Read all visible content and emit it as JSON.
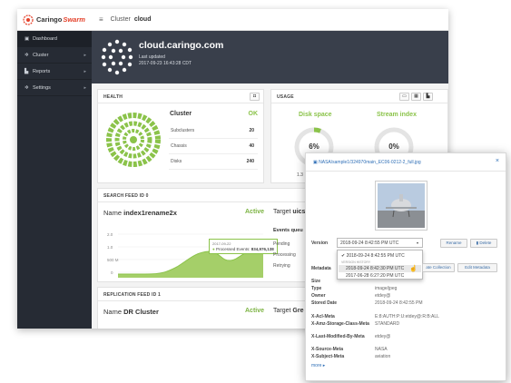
{
  "app": {
    "brand_name": "Caringo",
    "brand_product": "Swarm",
    "brand_color": "#e4412a"
  },
  "sidebar": {
    "items": [
      {
        "label": "Dashboard",
        "icon": "dashboard-icon",
        "has_chevron": false
      },
      {
        "label": "Cluster",
        "icon": "gear-icon",
        "has_chevron": true
      },
      {
        "label": "Reports",
        "icon": "bar-chart-icon",
        "has_chevron": true
      },
      {
        "label": "Settings",
        "icon": "gear-icon",
        "has_chevron": true
      }
    ]
  },
  "topbar": {
    "menu_icon": "hamburger-icon",
    "prefix": "Cluster",
    "name": "cloud"
  },
  "hero": {
    "cluster_name": "cloud.caringo.com",
    "last_updated_label": "Last updated",
    "timestamp": "2017-09-23  16:43:28 CDT"
  },
  "health": {
    "title": "HEALTH",
    "button_icon": "camera-icon",
    "cluster_label": "Cluster",
    "status": "OK",
    "status_color": "#8bc34a",
    "rows": [
      {
        "label": "Subclusters",
        "value": "20"
      },
      {
        "label": "Chassis",
        "value": "40"
      },
      {
        "label": "Disks",
        "value": "240"
      }
    ]
  },
  "usage": {
    "title": "USAGE",
    "buttons": [
      "window-icon",
      "grid-icon",
      "bar-chart-icon"
    ],
    "gauges": [
      {
        "label": "Disk space",
        "value": "6%",
        "fraction": 0.06
      },
      {
        "label": "Stream index",
        "value": "0%",
        "fraction": 0.0
      }
    ],
    "footnote": "1.3"
  },
  "search_feed": {
    "title": "SEARCH FEED ID 0",
    "name_prefix": "Name",
    "name": "index1rename2x",
    "status": "Active",
    "target_prefix": "Target",
    "target": "uics",
    "y_ticks": [
      "2.0",
      "1.0",
      "500 M",
      "0"
    ],
    "tooltip_date": "2017-09-22",
    "tooltip_label": "Processed Events:",
    "tooltip_value": "834,976,138",
    "events_label": "Events queu",
    "events_rows": [
      "Pending",
      "Processing",
      "Retrying"
    ]
  },
  "replication_feed": {
    "title": "REPLICATION FEED ID 1",
    "name_prefix": "Name",
    "name": "DR Cluster",
    "status": "Active",
    "target_prefix": "Target",
    "target": "Gre"
  },
  "popup": {
    "header_icon": "image-icon",
    "title": "NASA/sample1/324970main_EC06-0212-2_full.jpg",
    "close_icon": "close-icon",
    "version_label": "Version",
    "version_selected": "2018-09-24 8:42:55 PM UTC",
    "rename_btn": "Rename",
    "delete_btn": "Delete",
    "version_options": [
      {
        "text": "2018-09-24 8:42:55 PM UTC",
        "checked": true
      },
      {
        "text": "VERSION HISTORY",
        "header": true
      },
      {
        "text": "2018-09-24 8:42:30 PM UTC",
        "hover": true
      },
      {
        "text": "2017-06-28 6:27:20 PM UTC"
      }
    ],
    "metadata_label": "Metadata",
    "collection_btn": "ate Collection",
    "edit_meta_btn": "Edit Metadata",
    "fields": [
      {
        "key": "Size",
        "value": ""
      },
      {
        "key": "Type",
        "value": "image/jpeg"
      },
      {
        "key": "Owner",
        "value": "etdey@"
      },
      {
        "key": "Stored Date",
        "value": "2018-09-24 8:42:55 PM"
      }
    ],
    "meta_fields": [
      {
        "key": "X-Acl-Meta",
        "value": "E:8:AUTH:P:U:etdey@:R:B:ALL"
      },
      {
        "key": "X-Amz-Storage-Class-Meta",
        "value": "STANDARD"
      },
      {
        "key": "X-Last-Modified-By-Meta",
        "value": "etdey@"
      },
      {
        "key": "X-Source-Meta",
        "value": "NASA"
      },
      {
        "key": "X-Subject-Meta",
        "value": "aviation"
      }
    ],
    "more_link": "more ▸"
  }
}
